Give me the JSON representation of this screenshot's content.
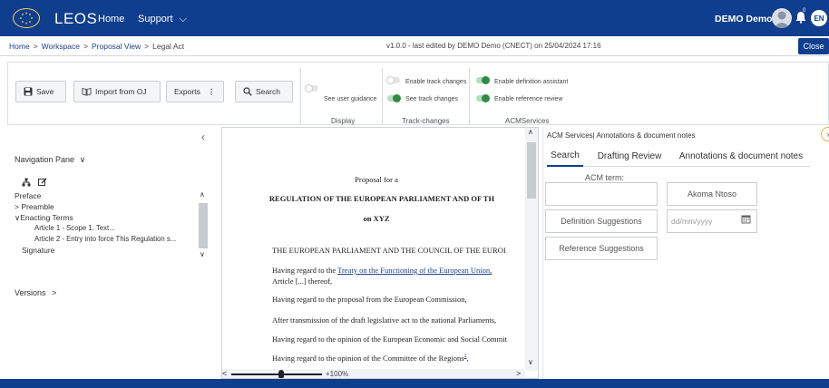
{
  "colors": {
    "header_bg": "#0f3e8e",
    "accent_green": "#2e8b45",
    "link": "#1e3f8a"
  },
  "header": {
    "brand": "LEOS",
    "nav": {
      "home": "Home",
      "support": "Support"
    },
    "user_name": "DEMO Demo",
    "notification_count": "0",
    "language": "EN"
  },
  "breadcrumb": {
    "items": [
      "Home",
      "Workspace",
      "Proposal View"
    ],
    "current": "Legal Act",
    "version_info": "v1.0.0 - last edited by DEMO Demo (CNECT) on 25/04/2024 17:16",
    "close_label": "Close"
  },
  "toolbar": {
    "save": "Save",
    "import": "Import from OJ",
    "exports": "Exports",
    "search": "Search",
    "user_guidance": "See user guidance",
    "enable_track": "Enable track changes",
    "see_track": "See track changes",
    "enable_definition": "Enable definition assistant",
    "enable_reference": "Enable reference review",
    "group_display": "Display",
    "group_track": "Track-changes",
    "group_acm": "ACMServices"
  },
  "nav_pane": {
    "title": "Navigation Pane",
    "tree": [
      {
        "label": "Preface",
        "level": 0
      },
      {
        "label": "> Preamble",
        "level": 0
      },
      {
        "label": "∨Enacting Terms",
        "level": 0
      },
      {
        "label": "Article 1 - Scope 1. Text...",
        "level": 2
      },
      {
        "label": "Article 2 - Entry into force This Regulation s...",
        "level": 2
      },
      {
        "label": "Signature",
        "level": 1
      }
    ],
    "versions": "Versions"
  },
  "document": {
    "proposal_for": "Proposal for a",
    "title": "REGULATION OF THE EUROPEAN PARLIAMENT AND OF TH",
    "subtitle": "on XYZ",
    "enacting": "THE EUROPEAN PARLIAMENT AND THE COUNCIL OF THE EUROI",
    "para1_a": "Having regard to the ",
    "para1_link": "Treaty on the Functioning of the European Union,",
    "para1_b": "Article [...] thereof,",
    "para2": "Having regard to the proposal from the European Commission,",
    "para3": "After transmission of the draft legislative act to the national Parliaments,",
    "para4": "Having regard to the opinion of the European Economic and Social Commit",
    "para5": "Having regard to the opinion of the Committee of the Regions",
    "para5_sup": "2",
    "para5_end": ",",
    "zoom": "+100%"
  },
  "right_pane": {
    "title": "ACM Services| Annotations & document notes",
    "tabs": [
      "Search",
      "Drafting Review",
      "Annotations & document notes"
    ],
    "acm_term_label": "ACM term:",
    "akoma": "Akoma Ntoso",
    "definition_suggestions": "Definition Suggestions",
    "date_placeholder": "dd/mm/yyyy",
    "reference_suggestions": "Reference Suggestions"
  }
}
